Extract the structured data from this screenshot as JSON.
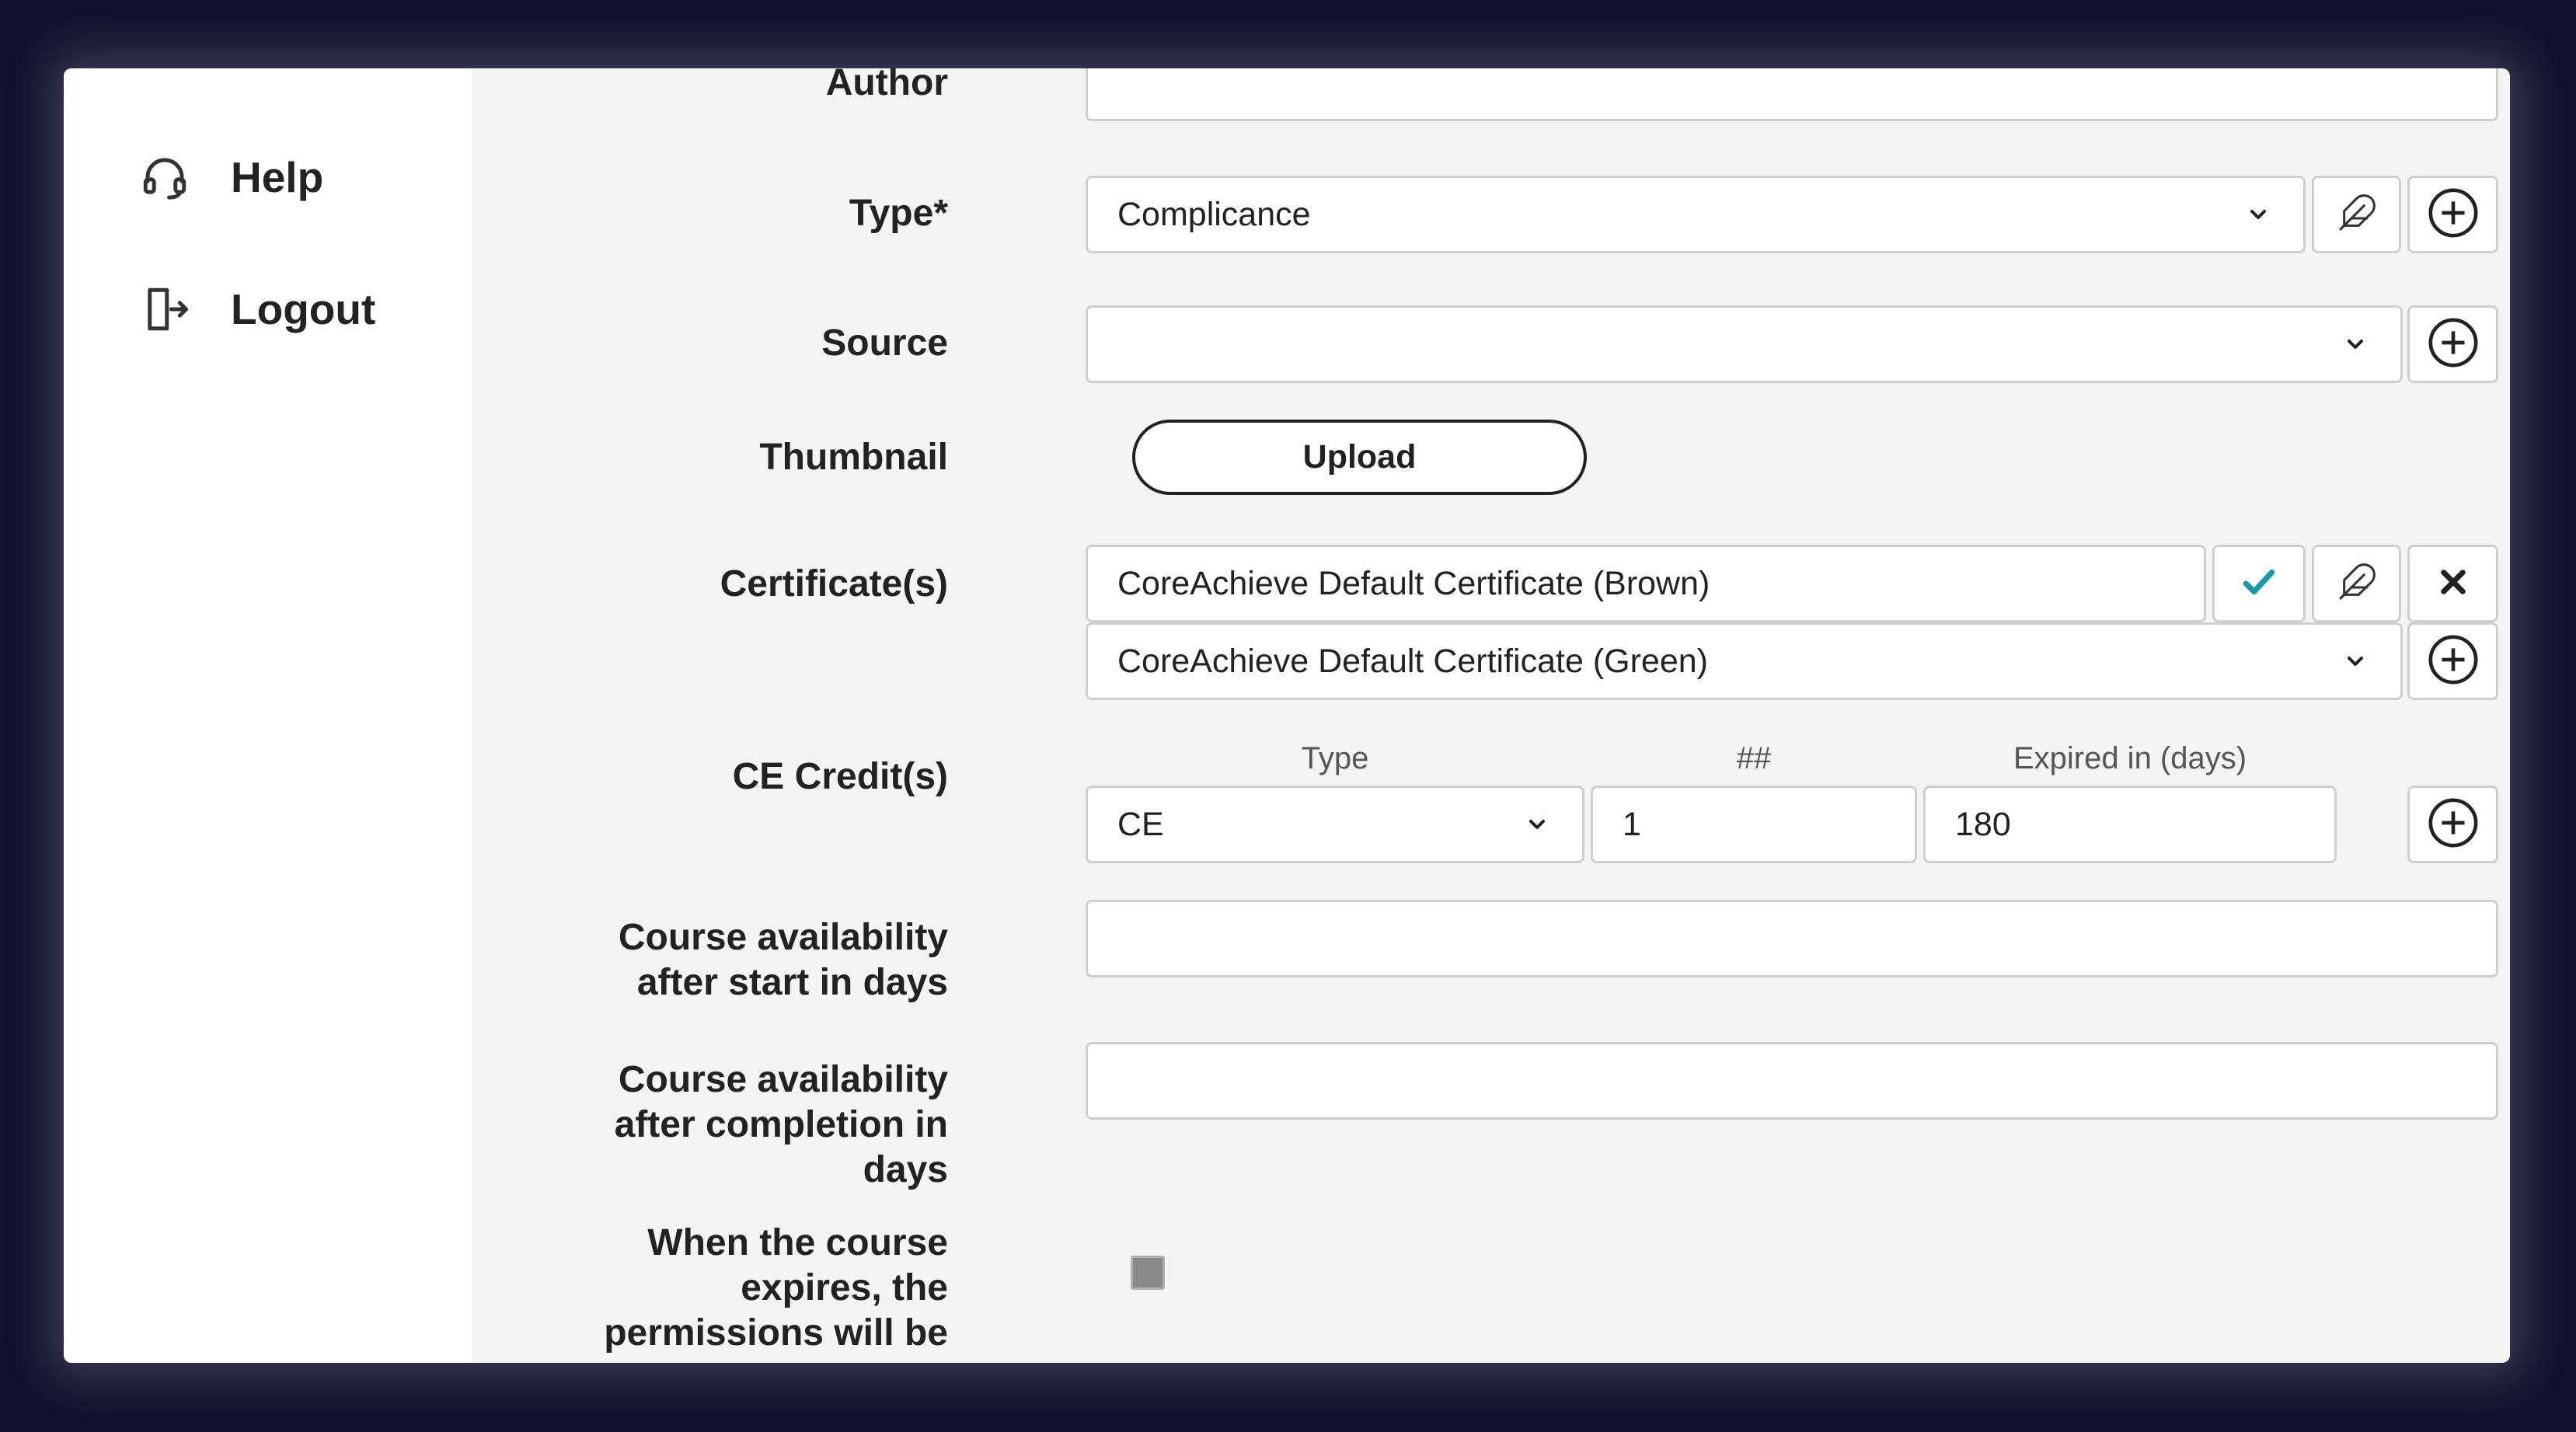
{
  "sidebar": {
    "items": [
      {
        "label": "Help",
        "icon": "headset-icon"
      },
      {
        "label": "Logout",
        "icon": "logout-icon"
      }
    ]
  },
  "form": {
    "author": {
      "label": "Author",
      "value": ""
    },
    "type": {
      "label": "Type*",
      "value": "Complicance"
    },
    "source": {
      "label": "Source",
      "value": ""
    },
    "thumbnail": {
      "label": "Thumbnail",
      "button": "Upload"
    },
    "certificates": {
      "label": "Certificate(s)",
      "selected": "CoreAchieve Default Certificate (Brown)",
      "dropdown": "CoreAchieve Default Certificate (Green)"
    },
    "ce_credits": {
      "label": "CE Credit(s)",
      "col_type": "Type",
      "col_num": "##",
      "col_expired": "Expired in (days)",
      "type_value": "CE",
      "num_value": "1",
      "expired_value": "180"
    },
    "availability_start": {
      "label_line1": "Course availability",
      "label_line2": "after start in days",
      "value": ""
    },
    "availability_completion": {
      "label_line1": "Course availability",
      "label_line2": "after completion in",
      "label_line3": "days",
      "value": ""
    },
    "expire_permissions": {
      "label_line1": "When the course",
      "label_line2": "expires, the",
      "label_line3": "permissions will be"
    }
  },
  "colors": {
    "accent": "#1a9aa8",
    "frame_bg": "#13112b"
  }
}
